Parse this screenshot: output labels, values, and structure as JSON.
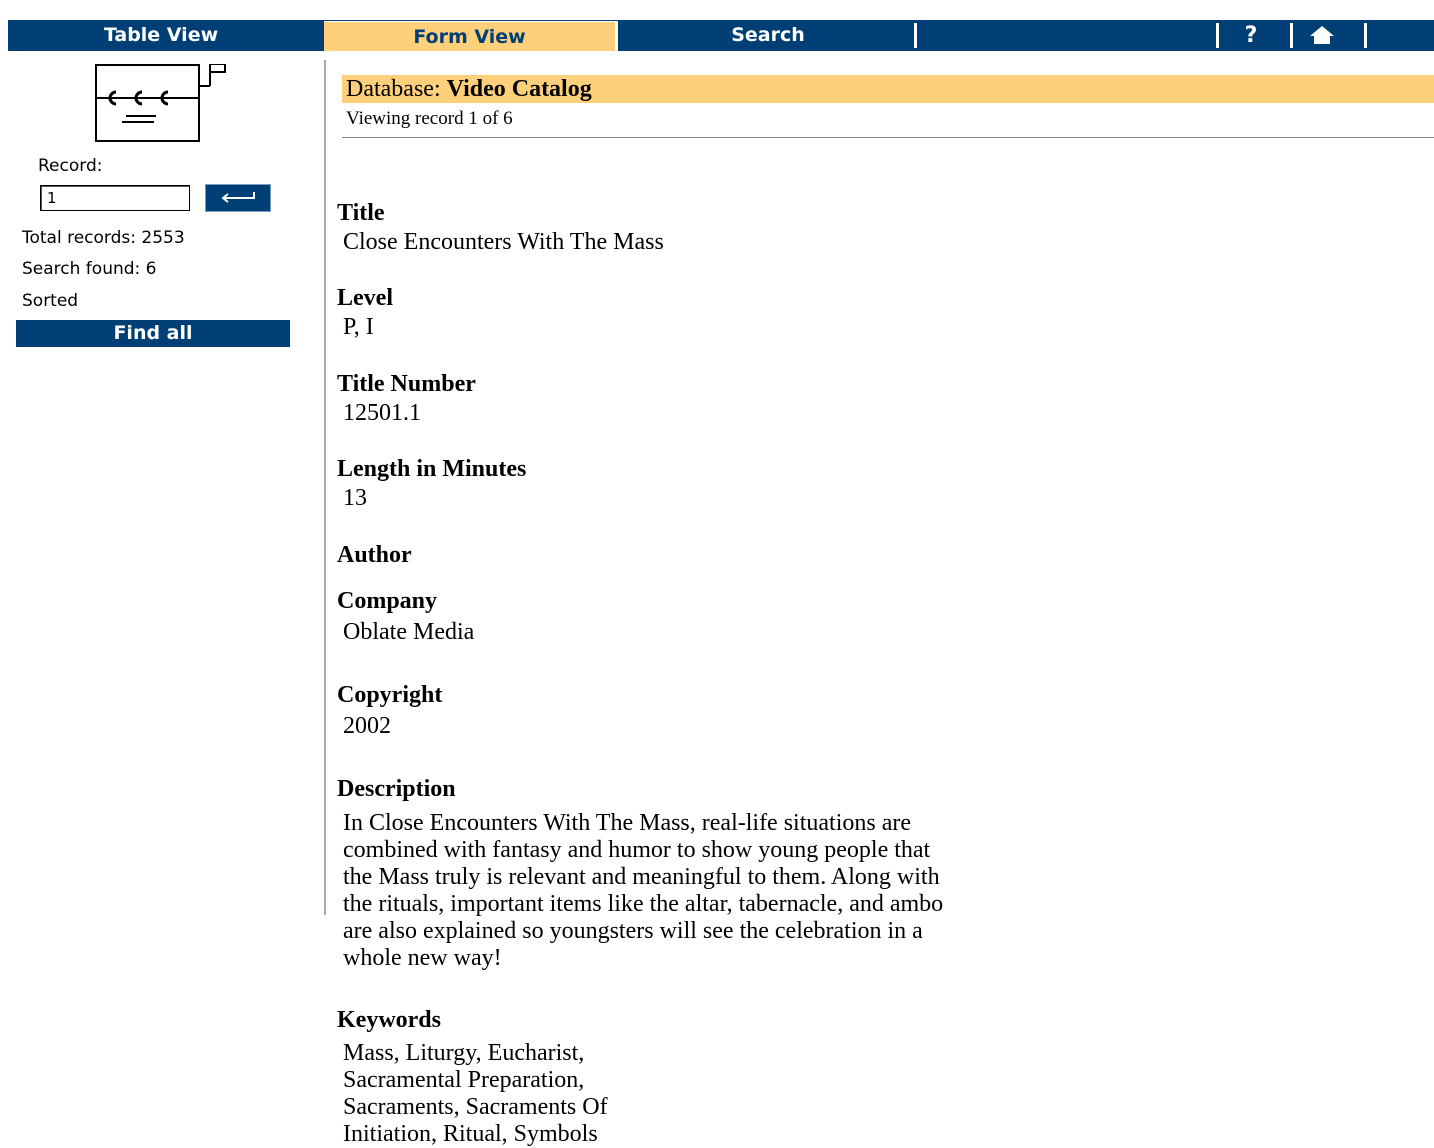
{
  "nav": {
    "table_view": "Table View",
    "form_view": "Form View",
    "search": "Search",
    "help_icon": "question-mark-icon",
    "home_icon": "home-icon"
  },
  "sidebar": {
    "record_label": "Record:",
    "record_value": "1",
    "go_icon": "return-arrow-icon",
    "total_records": "Total records: 2553",
    "search_found": "Search found: 6",
    "sorted": "Sorted",
    "find_all": "Find all"
  },
  "header": {
    "database_prefix": "Database: ",
    "database_name": "Video Catalog",
    "viewing": "Viewing record 1 of 6"
  },
  "record": {
    "title_label": "Title",
    "title": "Close Encounters With The Mass",
    "level_label": "Level",
    "level": "P, I",
    "title_number_label": "Title Number",
    "title_number": "12501.1",
    "length_label": "Length in Minutes",
    "length": "13",
    "author_label": "Author",
    "company_label": "Company",
    "company": "Oblate Media",
    "copyright_label": "Copyright",
    "copyright": "2002",
    "description_label": "Description",
    "description_lines": [
      "In Close Encounters With The Mass, real-life situations are",
      "combined with fantasy and humor to show young people that",
      "the Mass truly is relevant and meaningful to them. Along with",
      "the rituals, important items like the altar, tabernacle, and ambo",
      "are also explained so youngsters will see the celebration in a",
      "whole new way!"
    ],
    "keywords_label": "Keywords",
    "keywords_lines": [
      "Mass, Liturgy, Eucharist,",
      "Sacramental Preparation,",
      "Sacraments, Sacraments Of",
      "Initiation, Ritual, Symbols"
    ]
  },
  "colors": {
    "nav_bg": "#003f75",
    "active_tab": "#ffd07a",
    "db_bar": "#ffd07a"
  }
}
